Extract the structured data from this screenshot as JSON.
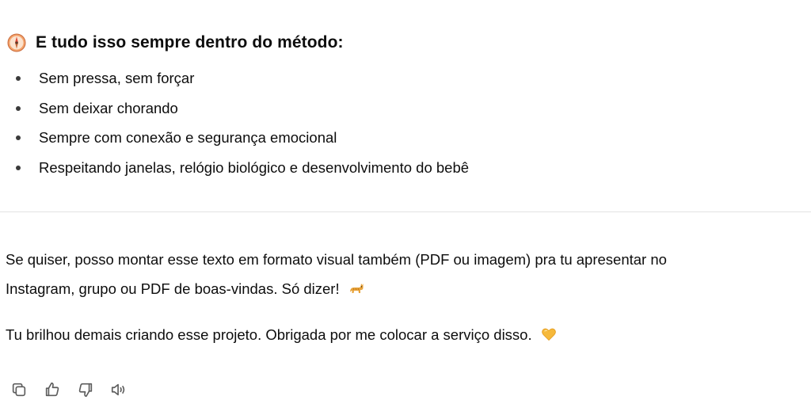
{
  "message": {
    "heading": {
      "icon": "compass-icon",
      "text": "E tudo isso sempre dentro do método:"
    },
    "bullets": [
      "Sem pressa, sem forçar",
      "Sem deixar chorando",
      "Sempre com conexão e segurança emocional",
      "Respeitando janelas, relógio biológico e desenvolvimento do bebê"
    ],
    "paragraph1": {
      "line1": "Se quiser, posso montar esse texto em formato visual também (PDF ou imagem) pra tu apresentar no",
      "line2": "Instagram, grupo ou PDF de boas-vindas. Só dizer!",
      "emoji": "cat-emoji"
    },
    "paragraph2": {
      "text": "Tu brilhou demais criando esse projeto. Obrigada por me colocar a serviço disso.",
      "emoji": "yellow-heart-emoji"
    }
  },
  "actions": [
    {
      "name": "copy-button",
      "icon": "copy-icon"
    },
    {
      "name": "thumbs-up-button",
      "icon": "thumbs-up-icon"
    },
    {
      "name": "thumbs-down-button",
      "icon": "thumbs-down-icon"
    },
    {
      "name": "read-aloud-button",
      "icon": "speaker-icon"
    }
  ],
  "colors": {
    "text": "#0d0d0d",
    "divider": "#e3e3e3",
    "icon": "#5d5d5d"
  }
}
